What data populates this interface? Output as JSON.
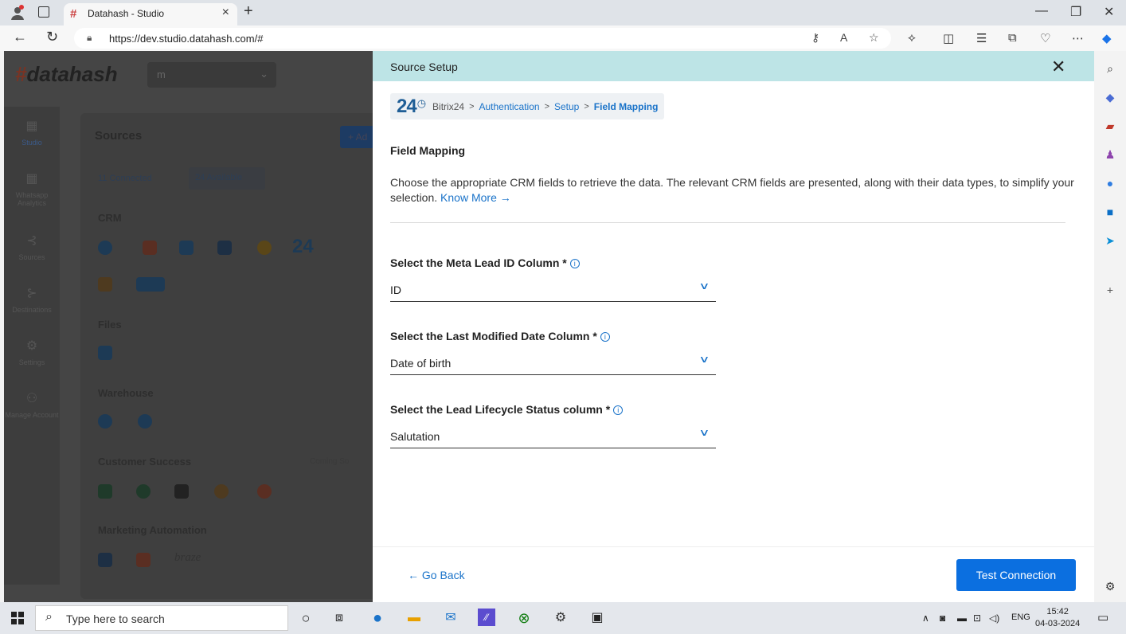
{
  "browser": {
    "tab_title": "Datahash - Studio",
    "url": "https://dev.studio.datahash.com/#"
  },
  "app": {
    "logo": "datahash",
    "workspace_value": "m",
    "nav": [
      "Studio",
      "Whatsapp Analytics",
      "Sources",
      "Destinations",
      "Settings",
      "Manage Account"
    ],
    "page_title": "Sources",
    "add_button": "+ Ad",
    "filter_connected": "11 Connected",
    "filter_available": "24 Available",
    "sections": [
      "CRM",
      "Files",
      "Warehouse",
      "Customer Success",
      "Marketing Automation"
    ],
    "coming_soon": "Coming So",
    "braze": "braze"
  },
  "panel": {
    "title": "Source Setup",
    "breadcrumb": {
      "logo": "24",
      "items": [
        "Bitrix24",
        "Authentication",
        "Setup",
        "Field Mapping"
      ]
    },
    "section_title": "Field Mapping",
    "description": "Choose the appropriate CRM fields to retrieve the data. The relevant CRM fields are presented, along with their data types, to simplify your selection.",
    "know_more": "Know More",
    "fields": [
      {
        "label": "Select the Meta Lead ID Column *",
        "value": "ID"
      },
      {
        "label": "Select the Last Modified Date Column *",
        "value": "Date of birth"
      },
      {
        "label": "Select the Lead Lifecycle Status column *",
        "value": "Salutation"
      }
    ],
    "go_back": "Go Back",
    "test_connection": "Test Connection"
  },
  "taskbar": {
    "search_placeholder": "Type here to search",
    "lang": "ENG",
    "time": "15:42",
    "date": "04-03-2024"
  }
}
